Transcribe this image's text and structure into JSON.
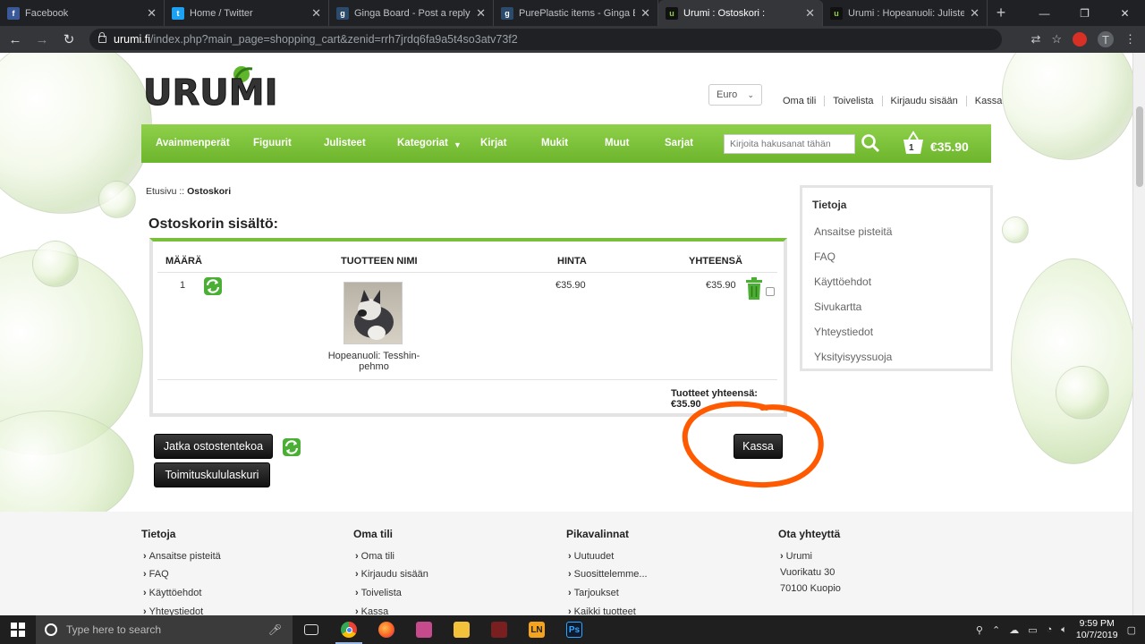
{
  "browser": {
    "tabs": [
      {
        "title": "Facebook",
        "favicon_color": "#3b5998",
        "favicon_glyph": "f"
      },
      {
        "title": "Home / Twitter",
        "favicon_color": "#1da1f2",
        "favicon_glyph": "t"
      },
      {
        "title": "Ginga Board - Post a reply",
        "favicon_color": "#2c4a6b",
        "favicon_glyph": "g"
      },
      {
        "title": "PurePlastic items - Ginga Bo",
        "favicon_color": "#2c4a6b",
        "favicon_glyph": "g"
      },
      {
        "title": "Urumi : Ostoskori :",
        "favicon_color": "#111111",
        "favicon_glyph": "u"
      },
      {
        "title": "Urumi : Hopeanuoli: Juliste: h",
        "favicon_color": "#111111",
        "favicon_glyph": "u"
      }
    ],
    "new_tab": "+",
    "url_host": "urumi.fi",
    "url_path": "/index.php?main_page=shopping_cart&zenid=rrh7jrdq6fa9a5t4so3atv73f2",
    "profile_initial": "T"
  },
  "header": {
    "logo_text": "URUMI",
    "currency": "Euro",
    "top_links": [
      "Oma tili",
      "Toivelista",
      "Kirjaudu sisään",
      "Kassa"
    ]
  },
  "nav": {
    "items": [
      "Avainmenperät",
      "Figuurit",
      "Julisteet",
      "Kategoriat",
      "Kirjat",
      "Mukit",
      "Muut",
      "Sarjat"
    ],
    "search_placeholder": "Kirjoita hakusanat tähän",
    "cart_count": "1",
    "cart_total": "€35.90"
  },
  "breadcrumb": {
    "home": "Etusivu",
    "sep": " :: ",
    "current": "Ostoskori"
  },
  "cart": {
    "title": "Ostoskorin sisältö:",
    "columns": [
      "MÄÄRÄ",
      "TUOTTEEN NIMI",
      "HINTA",
      "YHTEENSÄ"
    ],
    "rows": [
      {
        "qty": "1",
        "name": "Hopeanuoli: Tesshin-pehmo",
        "price": "€35.90",
        "total": "€35.90"
      }
    ],
    "subtotal": "Tuotteet yhteensä: €35.90",
    "continue_btn": "Jatka ostostentekoa",
    "shipping_btn": "Toimituskululaskuri",
    "checkout_btn": "Kassa"
  },
  "sidebar": {
    "title": "Tietoja",
    "links": [
      "Ansaitse pisteitä",
      "FAQ",
      "Käyttöehdot",
      "Sivukartta",
      "Yhteystiedot",
      "Yksityisyyssuoja"
    ]
  },
  "footer": {
    "columns": [
      {
        "title": "Tietoja",
        "links": [
          "Ansaitse pisteitä",
          "FAQ",
          "Käyttöehdot",
          "Yhteystiedot"
        ]
      },
      {
        "title": "Oma tili",
        "links": [
          "Oma tili",
          "Kirjaudu sisään",
          "Toivelista",
          "Kassa"
        ]
      },
      {
        "title": "Pikavalinnat",
        "links": [
          "Uutuudet",
          "Suosittelemme...",
          "Tarjoukset",
          "Kaikki tuotteet"
        ]
      },
      {
        "title": "Ota yhteyttä",
        "links": [
          "Urumi"
        ],
        "address": [
          "Vuorikatu 30",
          "70100 Kuopio"
        ]
      }
    ]
  },
  "taskbar": {
    "search_placeholder": "Type here to search",
    "time": "9:59 PM",
    "date": "10/7/2019",
    "apps": [
      "task-view",
      "chrome",
      "firefox",
      "snipping",
      "file-explorer",
      "game",
      "ln",
      "photoshop"
    ]
  },
  "colors": {
    "accent_green": "#6cb52c",
    "annotation_orange": "#ff5a00"
  }
}
